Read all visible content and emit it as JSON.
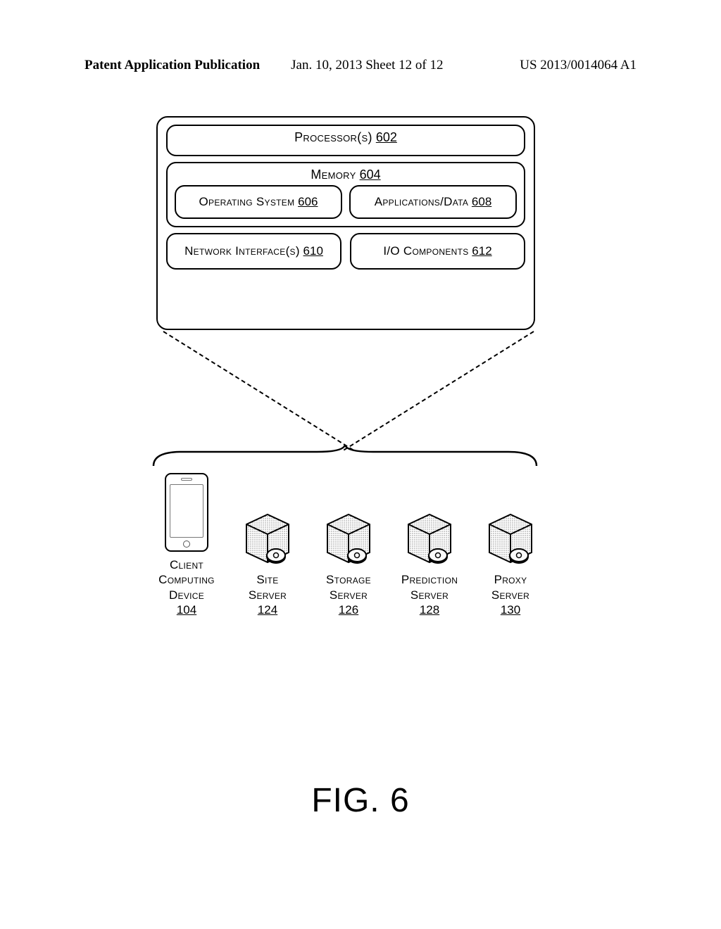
{
  "header": {
    "left": "Patent Application Publication",
    "center": "Jan. 10, 2013  Sheet 12 of 12",
    "right": "US 2013/0014064 A1"
  },
  "boxes": {
    "processor": {
      "label": "Processor(s)",
      "ref": "602"
    },
    "memory": {
      "label": "Memory",
      "ref": "604"
    },
    "os": {
      "label": "Operating System",
      "ref": "606"
    },
    "apps": {
      "label": "Applications/Data",
      "ref": "608"
    },
    "netif": {
      "label": "Network Interface(s)",
      "ref": "610"
    },
    "io": {
      "label": "I/O Components",
      "ref": "612"
    }
  },
  "devices": {
    "client": {
      "line1": "Client",
      "line2": "Computing",
      "line3": "Device",
      "ref": "104"
    },
    "site": {
      "line1": "Site",
      "line2": "Server",
      "ref": "124"
    },
    "storage": {
      "line1": "Storage",
      "line2": "Server",
      "ref": "126"
    },
    "prediction": {
      "line1": "Prediction",
      "line2": "Server",
      "ref": "128"
    },
    "proxy": {
      "line1": "Proxy",
      "line2": "Server",
      "ref": "130"
    }
  },
  "figure_label": "FIG. 6"
}
